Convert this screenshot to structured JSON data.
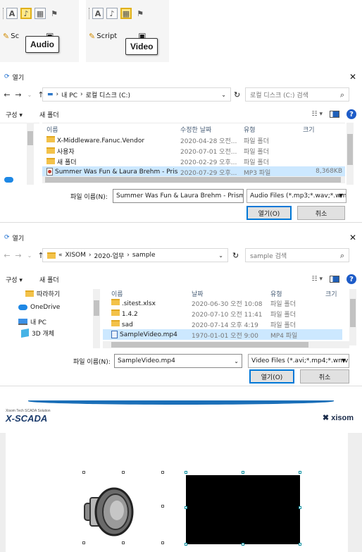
{
  "toolbar": {
    "script_label": "Script",
    "audio_callout": "Audio",
    "video_callout": "Video",
    "a_glyph": "A",
    "script_glyph": "Sc"
  },
  "dialog_audio": {
    "title": "열기",
    "breadcrumb": [
      "내 PC",
      "로컬 디스크 (C:)"
    ],
    "search_placeholder": "로컬 디스크 (C:) 검색",
    "organize": "구성 ▾",
    "new_folder": "새 폴더",
    "columns": {
      "name": "이름",
      "modified": "수정한 날짜",
      "type": "유형",
      "size": "크기"
    },
    "files": [
      {
        "name": "X-Middleware.Fanuc.Vendor",
        "modified": "2020-04-28 오전...",
        "type": "파일 폴더",
        "size": ""
      },
      {
        "name": "사용자",
        "modified": "2020-07-01 오전...",
        "type": "파일 폴더",
        "size": ""
      },
      {
        "name": "새 폴더",
        "modified": "2020-02-29 오후...",
        "type": "파일 폴더",
        "size": ""
      },
      {
        "name": "Summer Was Fun & Laura Brehm - Pris...",
        "modified": "2020-07-29 오후...",
        "type": "MP3 파일",
        "size": "8,368KB"
      }
    ],
    "filename_label": "파일 이름(N):",
    "filename_value": "Summer Was Fun & Laura Brehm - Prism",
    "filter": "Audio Files (*.mp3;*.wav;*.wm",
    "open_btn": "열기(O)",
    "cancel_btn": "취소"
  },
  "dialog_video": {
    "title": "열기",
    "breadcrumb": [
      "XISOM",
      "2020-업무",
      "sample"
    ],
    "search_placeholder": "sample 검색",
    "organize": "구성 ▾",
    "new_folder": "새 폴더",
    "tree": [
      "따라하기",
      "OneDrive",
      "내 PC",
      "3D 개체"
    ],
    "columns": {
      "name": "이름",
      "modified": "날짜",
      "type": "유형",
      "size": "크기"
    },
    "files": [
      {
        "name": ".sitest.xlsx",
        "modified": "2020-06-30 오전 10:08",
        "type": "파일 폴더"
      },
      {
        "name": "1.4.2",
        "modified": "2020-07-10 오전 11:41",
        "type": "파일 폴더"
      },
      {
        "name": "sad",
        "modified": "2020-07-14 오후 4:19",
        "type": "파일 폴더"
      },
      {
        "name": "SampleVideo.mp4",
        "modified": "1970-01-01 오전 9:00",
        "type": "MP4 파일"
      }
    ],
    "filename_label": "파일 이름(N):",
    "filename_value": "SampleVideo.mp4",
    "filter": "Video Files (*.avi;*.mp4;*.wmv;",
    "open_btn": "열기(O)",
    "cancel_btn": "취소"
  },
  "scada": {
    "logo": "X-SCADA",
    "logo_sub": "Xisom Tech SCADA Solution",
    "brand": "xisom"
  }
}
